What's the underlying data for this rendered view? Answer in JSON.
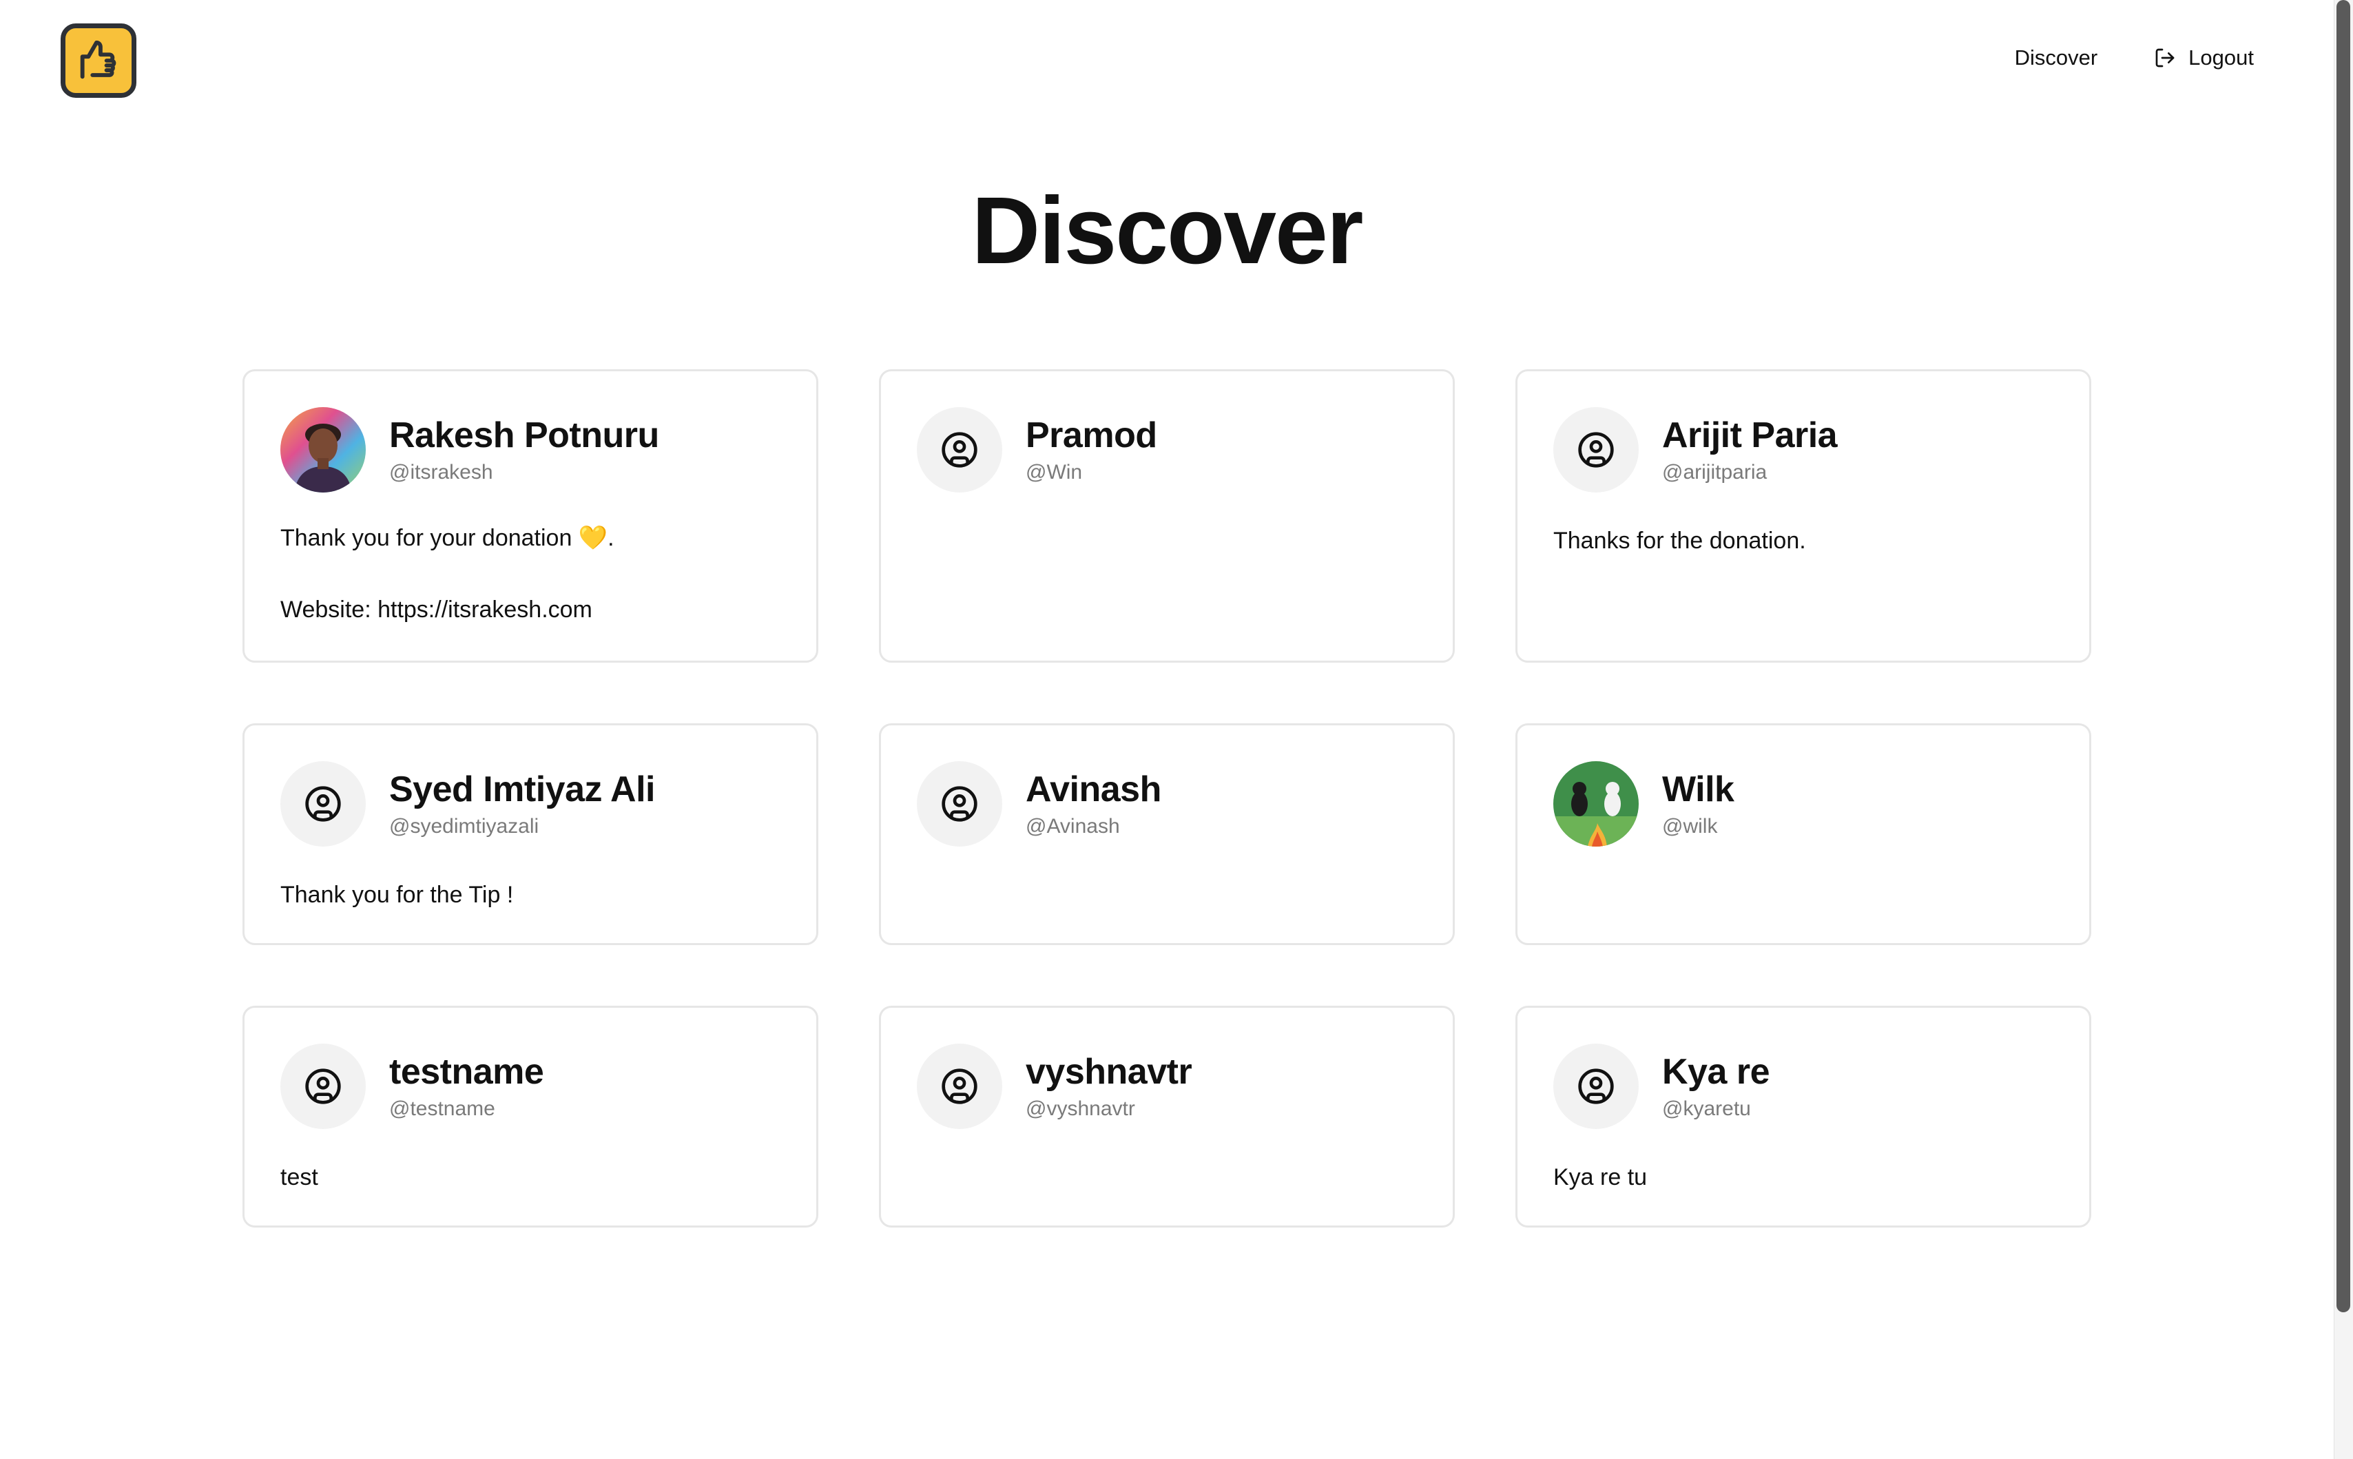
{
  "nav": {
    "discover": "Discover",
    "logout": "Logout"
  },
  "page": {
    "title": "Discover"
  },
  "accent": "#f8c13a",
  "cards": [
    {
      "name": "Rakesh Potnuru",
      "handle": "@itsrakesh",
      "bio": "Thank you for your donation 💛.\nWebsite: https://itsrakesh.com",
      "avatar": "photo"
    },
    {
      "name": "Pramod",
      "handle": "@Win",
      "bio": "",
      "avatar": "user-circle-icon"
    },
    {
      "name": "Arijit Paria",
      "handle": "@arijitparia",
      "bio": "Thanks for the donation.",
      "avatar": "user-circle-icon"
    },
    {
      "name": "Syed Imtiyaz Ali",
      "handle": "@syedimtiyazali",
      "bio": "Thank you for the Tip !",
      "avatar": "user-circle-icon"
    },
    {
      "name": "Avinash",
      "handle": "@Avinash",
      "bio": "",
      "avatar": "user-circle-icon"
    },
    {
      "name": "Wilk",
      "handle": "@wilk",
      "bio": "",
      "avatar": "photo"
    },
    {
      "name": "testname",
      "handle": "@testname",
      "bio": "test",
      "avatar": "user-circle-icon"
    },
    {
      "name": "vyshnavtr",
      "handle": "@vyshnavtr",
      "bio": "",
      "avatar": "user-circle-icon"
    },
    {
      "name": "Kya re",
      "handle": "@kyaretu",
      "bio": "Kya re tu",
      "avatar": "user-circle-icon"
    }
  ]
}
